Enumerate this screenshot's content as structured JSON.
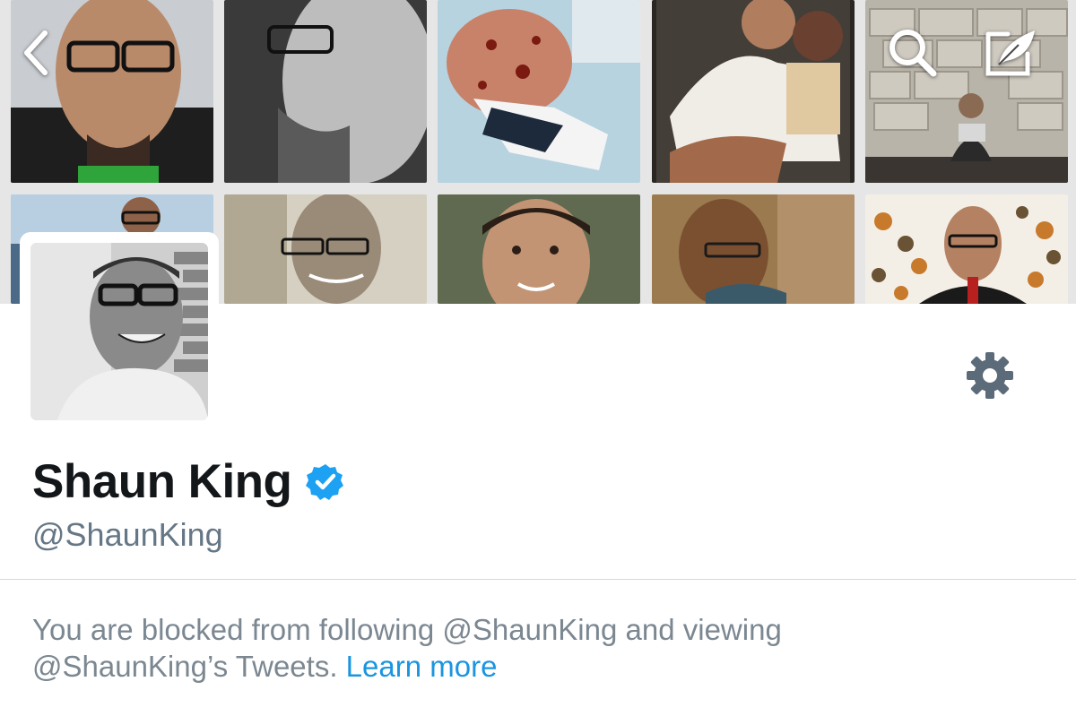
{
  "profile": {
    "name": "Shaun King",
    "handle": "@ShaunKing",
    "verified": true
  },
  "notice": {
    "blocked_text": "You are blocked from following @ShaunKing and viewing @ShaunKing’s Tweets.",
    "learn_more": "Learn more"
  },
  "icons": {
    "back": "chevron-left-icon",
    "search": "search-icon",
    "compose": "compose-tweet-icon",
    "settings": "gear-icon",
    "verified": "verified-badge-icon"
  },
  "colors": {
    "name": "#14171a",
    "handle": "#657786",
    "body_text": "#7b8791",
    "link": "#1b95e0",
    "verified": "#1da1f2",
    "gear": "#5c6b7a"
  }
}
